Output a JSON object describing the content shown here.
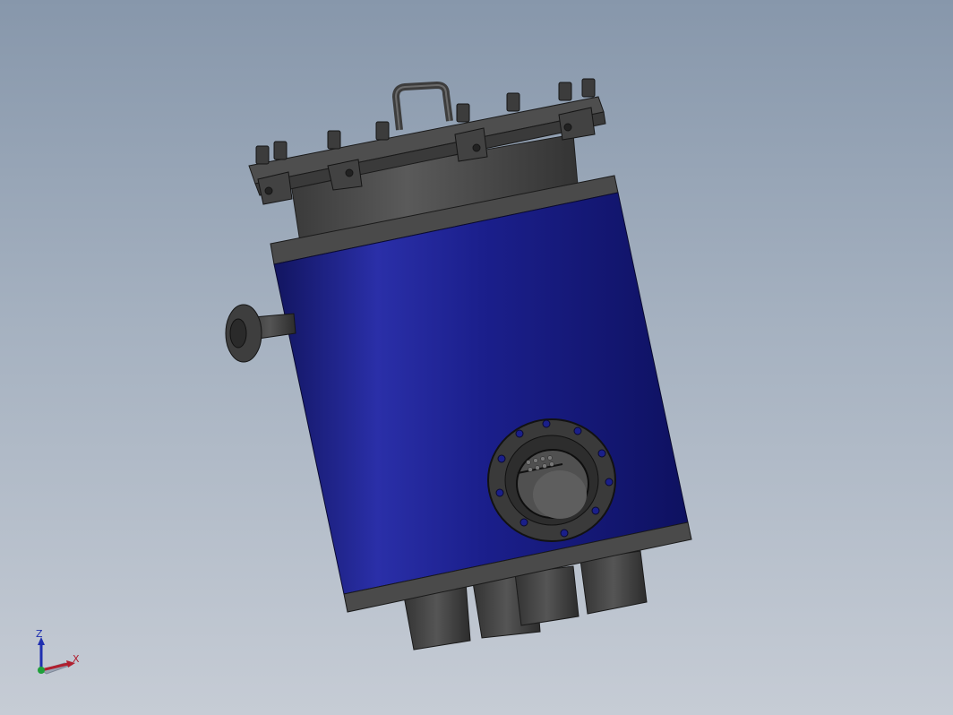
{
  "viewport": {
    "background_top": "#8797ab",
    "background_bottom": "#c6ccd5"
  },
  "model": {
    "body_color": "#1a1f8a",
    "metal_color": "#4a4a4a",
    "dark_metal_color": "#2e2e2e"
  },
  "triad": {
    "z_label": "Z",
    "x_label": "X",
    "z_color": "#1f2fb0",
    "x_color": "#b01f2f",
    "y_color": "#1fa03a"
  }
}
